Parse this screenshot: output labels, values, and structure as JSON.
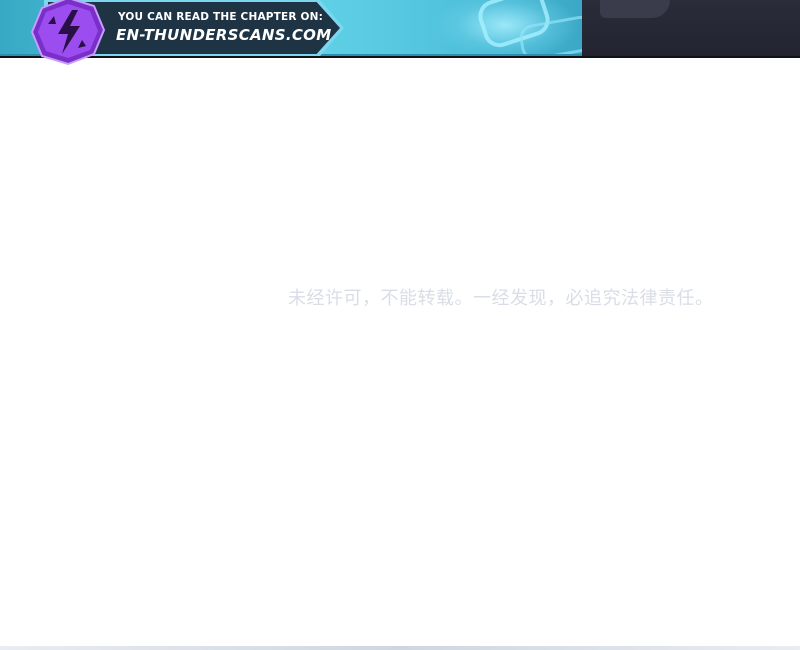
{
  "banner": {
    "read_label": "YOU CAN READ THE CHAPTER ON:",
    "site": "EN-THUNDERSCANS.COM",
    "logo_icon": "lightning-bolt-icon",
    "colors": {
      "banner_bg": "#1e3344",
      "banner_edge": "#7bd7ef",
      "logo_purple": "#8b3fd9",
      "art_blue": "#4fc4dc",
      "art_dark": "#262835"
    }
  },
  "notice": {
    "text": "未经许可，不能转载。一经发现，必追究法律责任。",
    "color": "#d9dde6"
  },
  "page": {
    "background": "#ffffff"
  }
}
